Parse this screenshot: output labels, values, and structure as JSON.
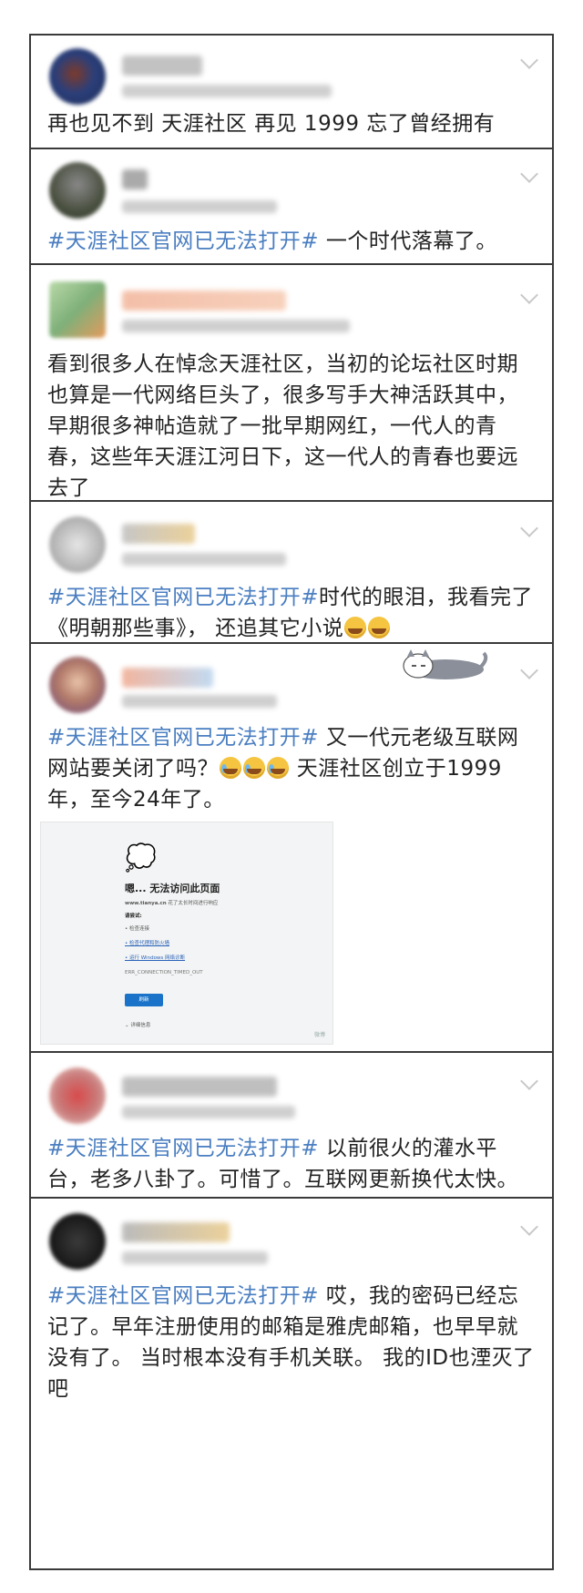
{
  "posts": [
    {
      "text": "再也见不到 天涯社区 再见 1999 忘了曾经拥有"
    },
    {
      "tag": "#天涯社区官网已无法打开#",
      "text": " 一个时代落幕了。"
    },
    {
      "text": "看到很多人在悼念天涯社区，当初的论坛社区时期也算是一代网络巨头了，很多写手大神活跃其中，早期很多神帖造就了一批早期网红，一代人的青春，这些年天涯江河日下，这一代人的青春也要远去了"
    },
    {
      "tag": "#天涯社区官网已无法打开#",
      "text": "时代的眼泪，我看完了《明朝那些事》， 还追其它小说"
    },
    {
      "tag": "#天涯社区官网已无法打开#",
      "text_a": " 又一代元老级互联网网站要关闭了吗？",
      "text_b": " 天涯社区创立于1999年，至今24年了。"
    },
    {
      "tag": "#天涯社区官网已无法打开#",
      "text": " 以前很火的灌水平台，老多八卦了。可惜了。互联网更新换代太快。"
    },
    {
      "tag": "#天涯社区官网已无法打开#",
      "text": " 哎，我的密码已经忘记了。早年注册使用的邮箱是雅虎邮箱，也早早就没有了。 当时根本没有手机关联。 我的ID也湮灭了吧"
    }
  ],
  "screenshot": {
    "icon": "thought-cloud-icon",
    "title": "嗯... 无法访问此页面",
    "line1_domain": "www.tianya.cn",
    "line1_rest": " 花了太长时间进行响应",
    "try_label": "请尝试:",
    "bullet1": "• 检查连接",
    "bullet2": "• 检查代理和防火墙",
    "bullet3": "• 运行 Windows 网络诊断",
    "error_code": "ERR_CONNECTION_TIMED_OUT",
    "button": "刷新",
    "details": "⌄ 详细信息",
    "watermark": "微博"
  },
  "colors": {
    "tag": "#4a7ec1",
    "border": "#3a3a3a"
  }
}
